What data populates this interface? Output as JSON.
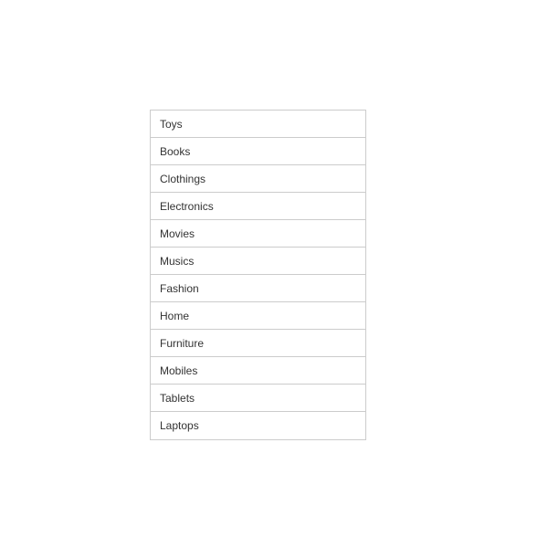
{
  "categories": {
    "items": [
      {
        "label": "Toys"
      },
      {
        "label": "Books"
      },
      {
        "label": "Clothings"
      },
      {
        "label": "Electronics"
      },
      {
        "label": "Movies"
      },
      {
        "label": "Musics"
      },
      {
        "label": "Fashion"
      },
      {
        "label": "Home"
      },
      {
        "label": "Furniture"
      },
      {
        "label": "Mobiles"
      },
      {
        "label": "Tablets"
      },
      {
        "label": "Laptops"
      }
    ]
  }
}
